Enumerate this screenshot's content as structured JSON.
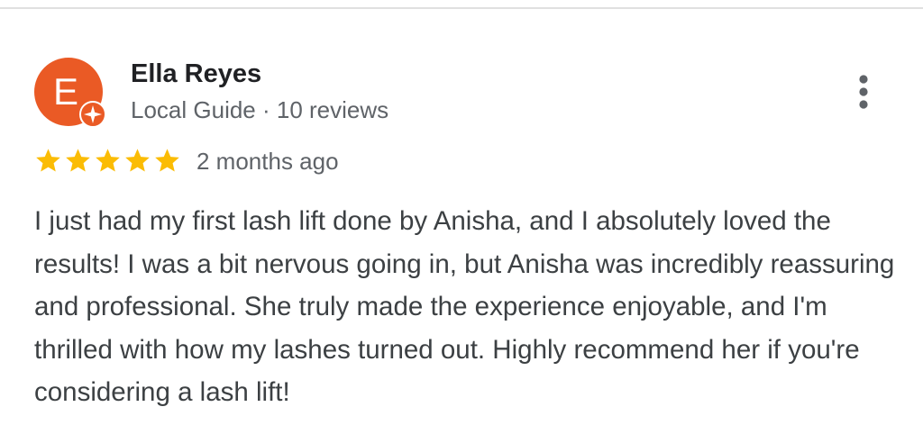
{
  "reviewer": {
    "initial": "E",
    "name": "Ella Reyes",
    "meta": "Local Guide · 10 reviews",
    "avatar_color": "#ea5a25",
    "badge_icon": "local-guide-star-icon"
  },
  "review": {
    "rating": 5,
    "max_rating": 5,
    "star_color": "#fbbc04",
    "timestamp": "2 months ago",
    "text": "I just had my first lash lift done by Anisha, and I absolutely loved the results! I was a bit nervous going in, but Anisha was incredibly reassuring and professional. She truly made the experience enjoyable, and I'm thrilled with how my lashes turned out. Highly recommend her if you're considering a lash lift!"
  },
  "actions": {
    "more_icon": "more-vert-icon"
  }
}
